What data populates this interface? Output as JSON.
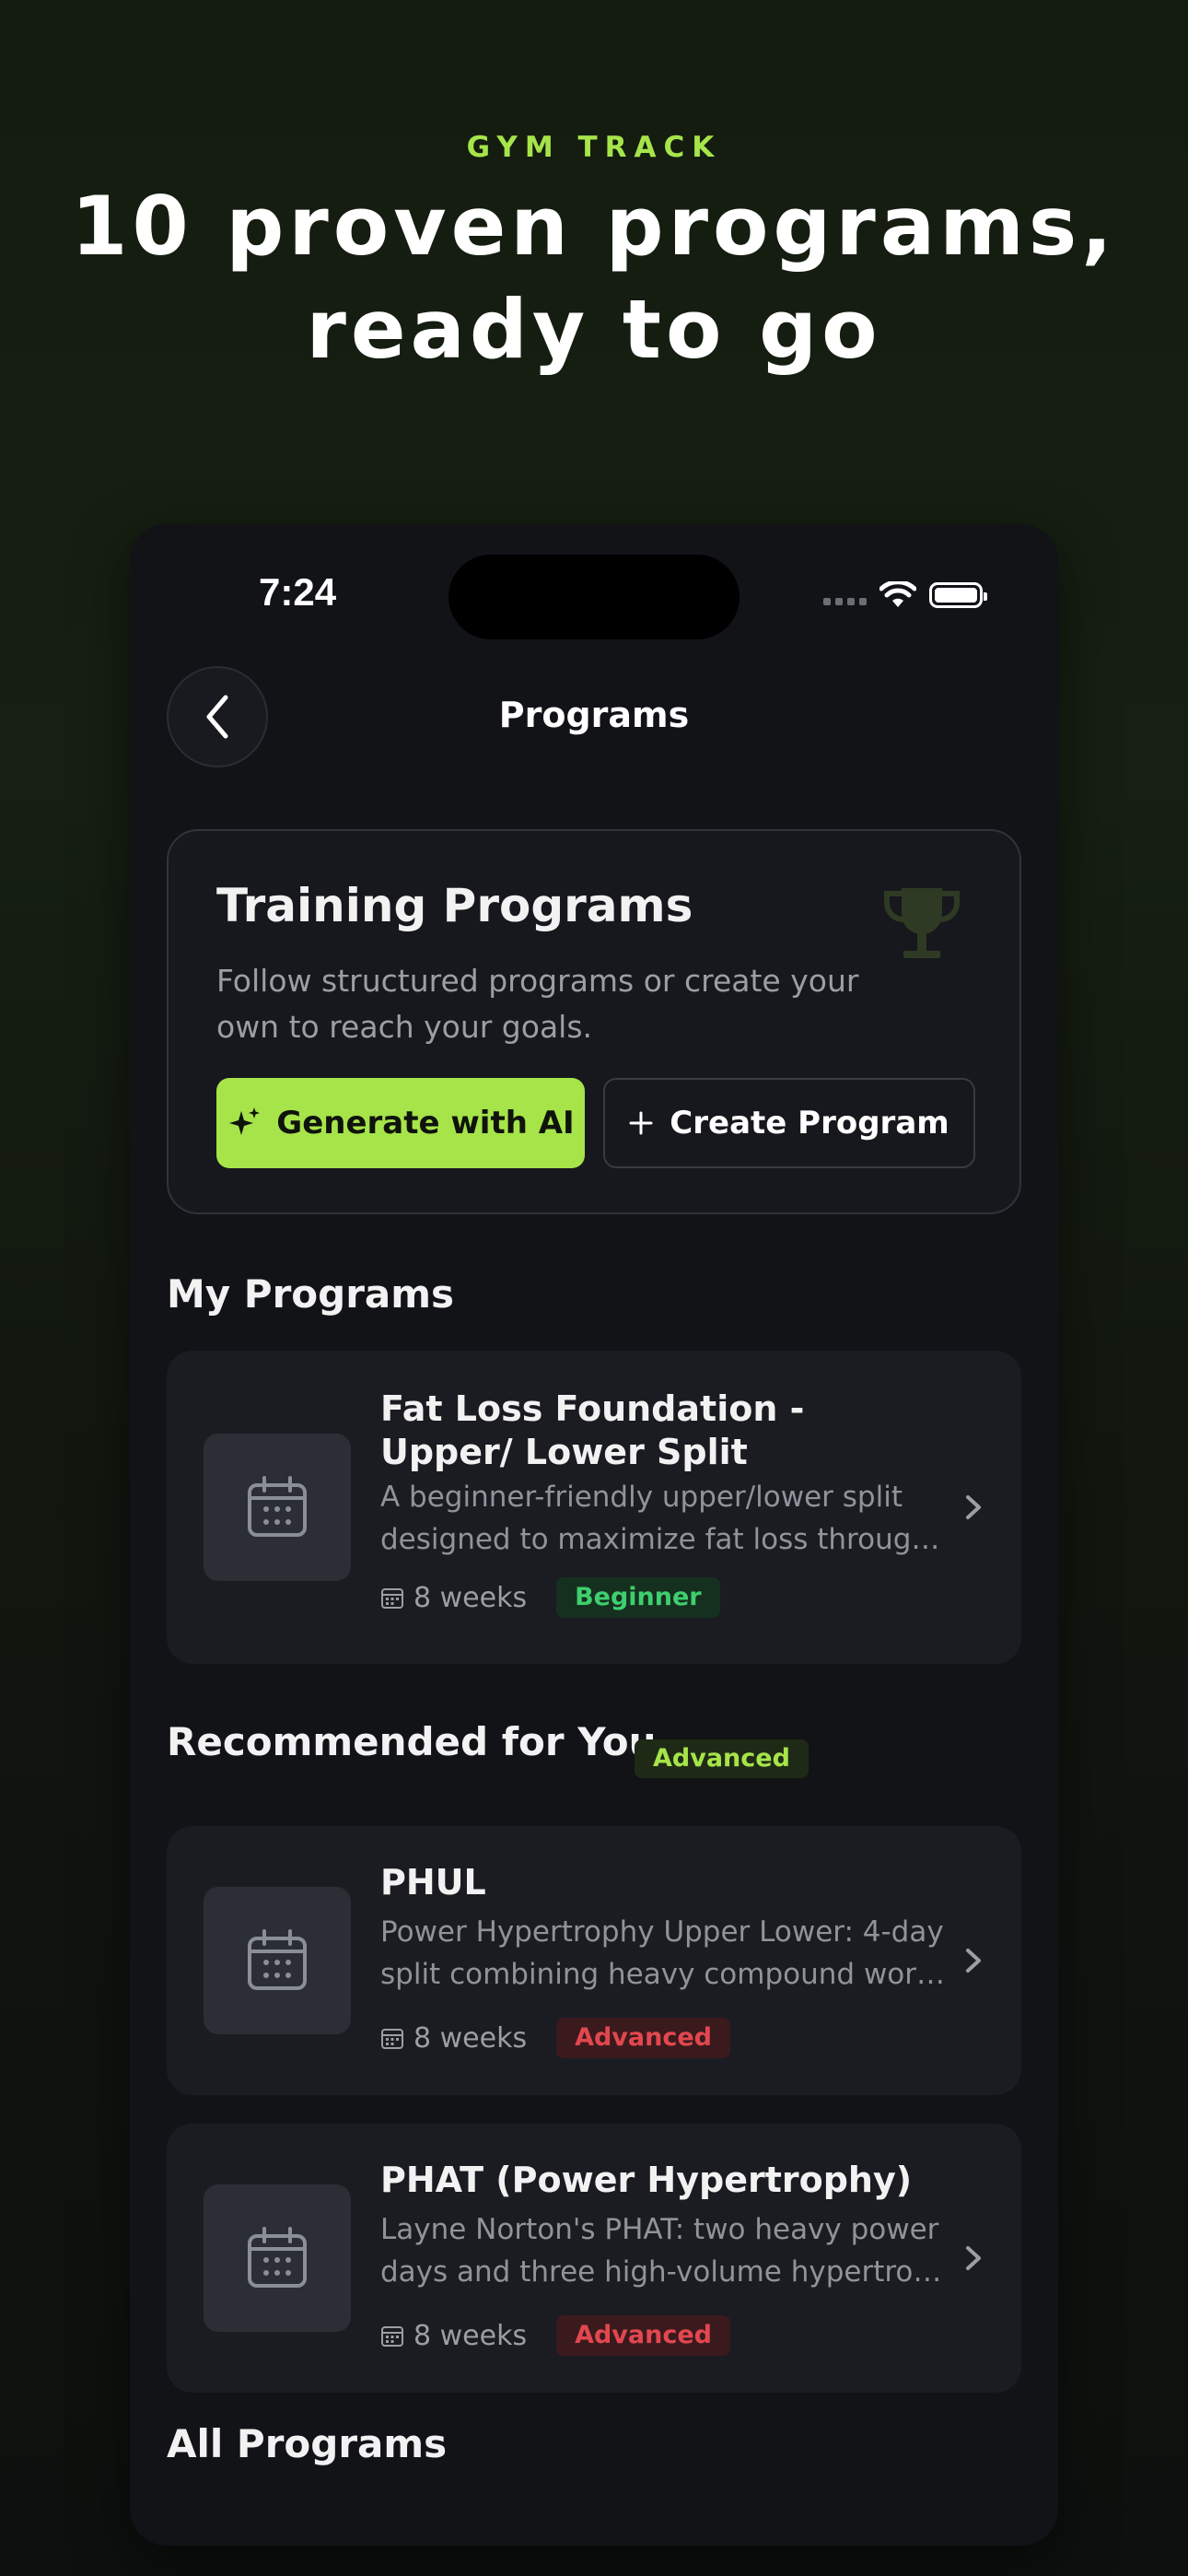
{
  "hero": {
    "eyebrow": "GYM TRACK",
    "title_line1": "10 proven programs,",
    "title_line2": "ready to go"
  },
  "status_bar": {
    "time": "7:24"
  },
  "nav": {
    "title": "Programs"
  },
  "intro_card": {
    "title": "Training Programs",
    "description": "Follow structured programs or create your own to reach your goals.",
    "generate_label": "Generate with AI",
    "create_label": "Create Program"
  },
  "my_programs": {
    "heading": "My Programs",
    "items": [
      {
        "name": "Fat Loss Foundation - Upper/ Lower Split",
        "desc_line1": "A beginner-friendly upper/lower split",
        "desc_line2": "designed to maximize fat loss through...",
        "weeks": "8 weeks",
        "level": "Beginner"
      }
    ]
  },
  "recommended": {
    "heading": "Recommended for You",
    "badge": "Advanced",
    "items": [
      {
        "name": "PHUL",
        "desc_line1": "Power Hypertrophy Upper Lower: 4-day",
        "desc_line2": "split combining heavy compound work...",
        "weeks": "8 weeks",
        "level": "Advanced"
      },
      {
        "name": "PHAT (Power Hypertrophy)",
        "desc_line1": "Layne Norton's PHAT: two heavy power",
        "desc_line2": "days and three high-volume hypertrop...",
        "weeks": "8 weeks",
        "level": "Advanced"
      }
    ]
  },
  "all_programs": {
    "heading": "All Programs"
  },
  "colors": {
    "accent": "#a6e44a",
    "beginner": "#3ecf6e",
    "advanced": "#e2474f",
    "background": "#111317"
  }
}
